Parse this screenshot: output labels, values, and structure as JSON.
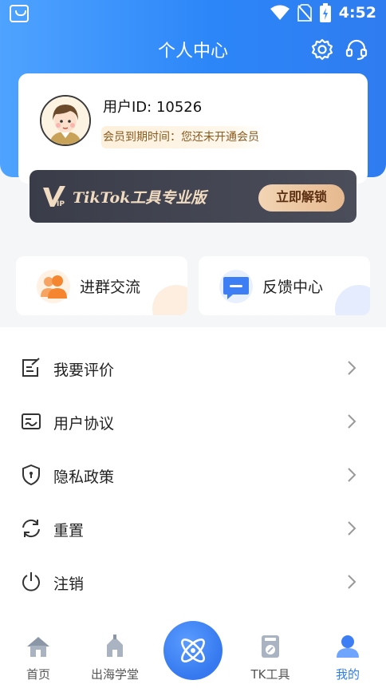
{
  "status_bar": {
    "time": "4:52"
  },
  "header": {
    "title": "个人中心",
    "settings_icon": "gear-icon",
    "service_icon": "headset-icon"
  },
  "profile": {
    "user_id": "用户ID: 10526",
    "membership": "会员到期时间：您还未开通会员"
  },
  "vip": {
    "title": "TikTok工具专业版",
    "unlock_label": "立即解锁"
  },
  "quick_actions": [
    {
      "label": "进群交流",
      "icon": "group-chat-icon"
    },
    {
      "label": "反馈中心",
      "icon": "feedback-icon"
    }
  ],
  "menu": [
    {
      "label": "我要评价",
      "icon": "edit-review-icon"
    },
    {
      "label": "用户协议",
      "icon": "agreement-icon"
    },
    {
      "label": "隐私政策",
      "icon": "shield-icon"
    },
    {
      "label": "重置",
      "icon": "refresh-icon"
    },
    {
      "label": "注销",
      "icon": "power-icon"
    }
  ],
  "tabbar": [
    {
      "label": "首页",
      "icon": "home-icon"
    },
    {
      "label": "出海学堂",
      "icon": "school-icon"
    },
    {
      "label": "TK工具",
      "icon": "tools-icon"
    },
    {
      "label": "我的",
      "icon": "profile-icon",
      "active": true
    }
  ],
  "colors": {
    "primary": "#2f83f7",
    "active_tab": "#2f7cf0",
    "vip_gold": "#e6b98f"
  }
}
